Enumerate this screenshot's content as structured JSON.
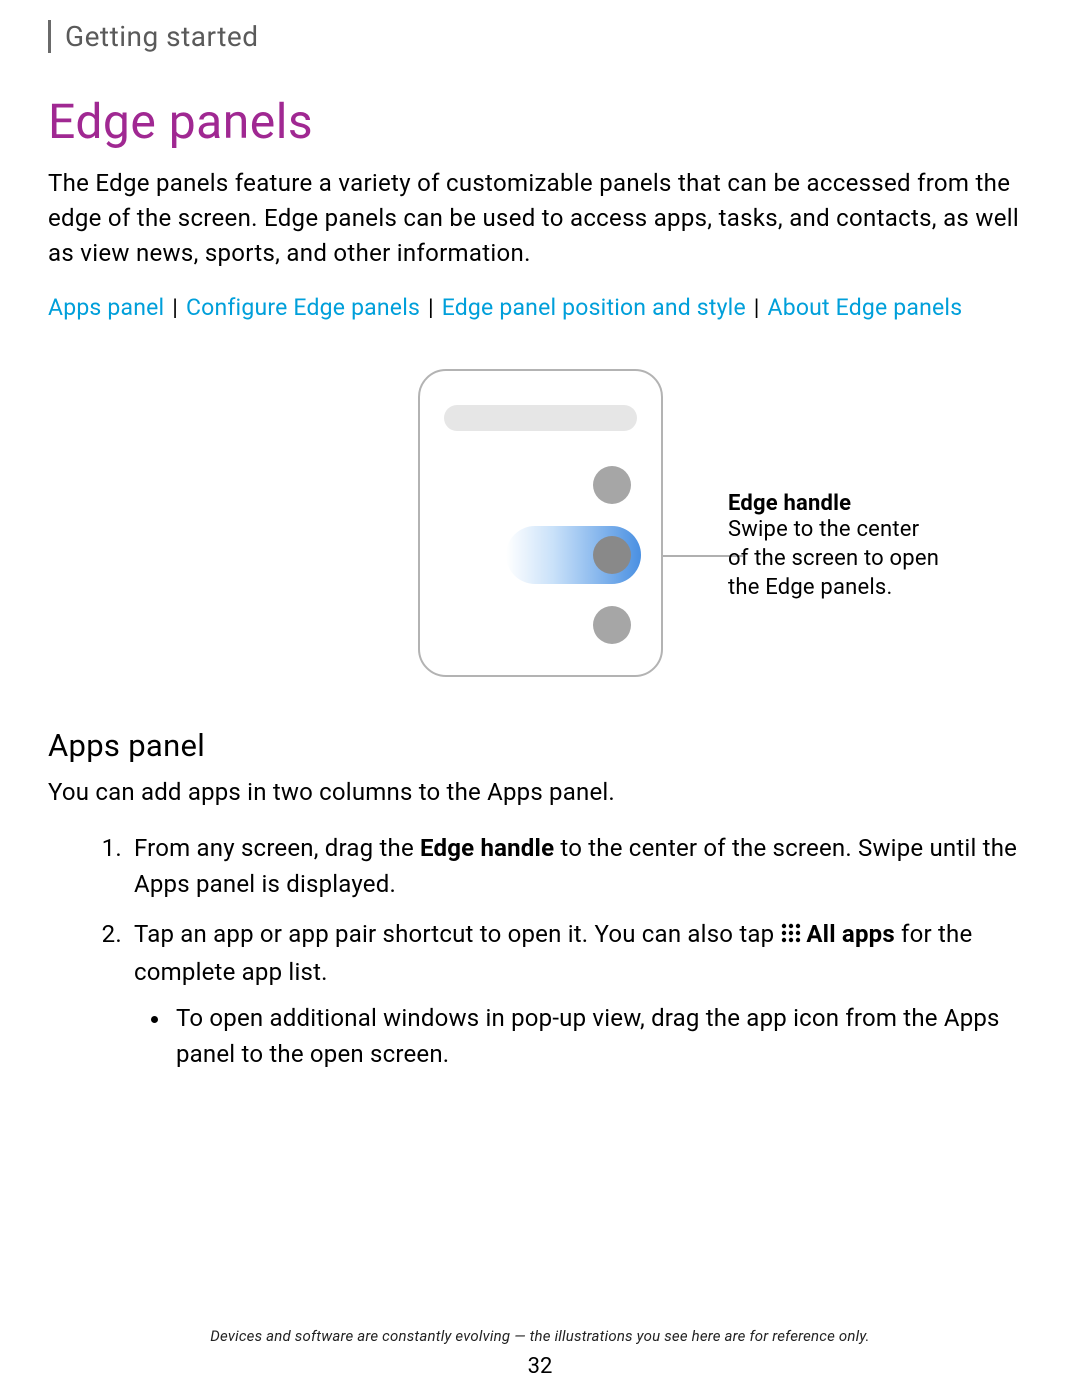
{
  "breadcrumb": "Getting started",
  "title": "Edge panels",
  "intro": "The Edge panels feature a variety of customizable panels that can be accessed from the edge of the screen. Edge panels can be used to access apps, tasks, and contacts, as well as view news, sports, and other information.",
  "links": {
    "l1": "Apps panel",
    "l2": "Configure Edge panels",
    "l3": "Edge panel position and style",
    "l4": "About Edge panels"
  },
  "callout": {
    "title": "Edge handle",
    "text": "Swipe to the center of the screen to open the Edge panels."
  },
  "apps_panel": {
    "heading": "Apps panel",
    "intro": "You can add apps in two columns to the Apps panel.",
    "step1_before": "From any screen, drag the ",
    "step1_bold": "Edge handle",
    "step1_after": " to the center of the screen. Swipe until the Apps panel is displayed.",
    "step2_before": "Tap an app or app pair shortcut to open it. You can also tap",
    "step2_bold": "All apps",
    "step2_after": " for the complete app list.",
    "bullet1": "To open additional windows in pop-up view, drag the app icon from the Apps panel to the open screen."
  },
  "footer": "Devices and software are constantly evolving — the illustrations you see here are for reference only.",
  "page_number": "32"
}
